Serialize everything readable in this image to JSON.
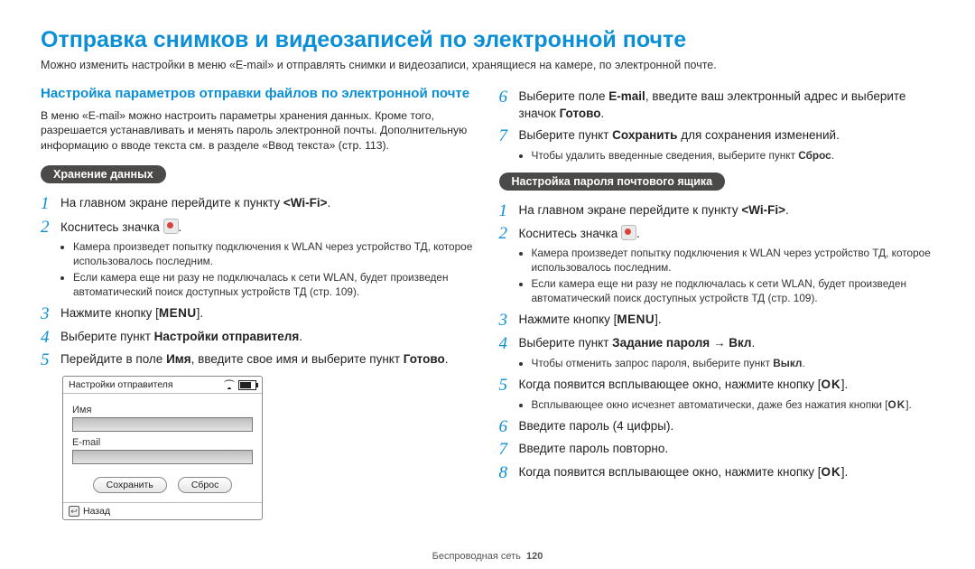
{
  "title": "Отправка снимков и видеозаписей по электронной почте",
  "subtitle": "Можно изменить настройки в меню «E-mail» и отправлять снимки и видеозаписи, хранящиеся на камере, по электронной почте.",
  "left": {
    "heading": "Настройка параметров отправки файлов по электронной почте",
    "intro": "В меню «E-mail» можно настроить параметры хранения данных. Кроме того, разрешается устанавливать и менять пароль электронной почты. Дополнительную информацию о вводе текста см. в разделе «Ввод текста» (стр. 113).",
    "pill": "Хранение данных",
    "s1_a": "На главном экране перейдите к пункту ",
    "s1_b": "<Wi-Fi>",
    "s1_c": ".",
    "s2_a": "Коснитесь значка ",
    "s2_b": ".",
    "b1": "Камера произведет попытку подключения к WLAN через устройство ТД, которое использовалось последним.",
    "b2": "Если камера еще ни разу не подключалась к сети WLAN, будет произведен автоматический поиск доступных устройств ТД (стр. 109).",
    "s3_a": "Нажмите кнопку [",
    "s3_menu": "MENU",
    "s3_b": "].",
    "s4_a": "Выберите пункт ",
    "s4_b": "Настройки отправителя",
    "s4_c": ".",
    "s5_a": "Перейдите в поле ",
    "s5_b": "Имя",
    "s5_c": ", введите свое имя и выберите пункт ",
    "s5_d": "Готово",
    "s5_e": "."
  },
  "device": {
    "title": "Настройки отправителя",
    "label_name": "Имя",
    "label_email": "E-mail",
    "btn_save": "Сохранить",
    "btn_reset": "Сброс",
    "back": "Назад"
  },
  "right_top": {
    "s6_a": "Выберите поле ",
    "s6_b": "E-mail",
    "s6_c": ", введите ваш электронный адрес и выберите значок ",
    "s6_d": "Готово",
    "s6_e": ".",
    "s7_a": "Выберите пункт ",
    "s7_b": "Сохранить",
    "s7_c": " для сохранения изменений.",
    "b1_a": "Чтобы удалить введенные сведения, выберите пункт ",
    "b1_b": "Сброс",
    "b1_c": "."
  },
  "right": {
    "pill": "Настройка пароля почтового ящика",
    "s1_a": "На главном экране перейдите к пункту ",
    "s1_b": "<Wi-Fi>",
    "s1_c": ".",
    "s2_a": "Коснитесь значка ",
    "s2_b": ".",
    "b1": "Камера произведет попытку подключения к WLAN через устройство ТД, которое использовалось последним.",
    "b2": "Если камера еще ни разу не подключалась к сети WLAN, будет произведен автоматический поиск доступных устройств ТД (стр. 109).",
    "s3_a": "Нажмите кнопку [",
    "s3_menu": "MENU",
    "s3_b": "].",
    "s4_a": "Выберите пункт ",
    "s4_b": "Задание пароля",
    "s4_arrow": " → ",
    "s4_c": "Вкл",
    "s4_d": ".",
    "b3_a": "Чтобы отменить запрос пароля, выберите пункт ",
    "b3_b": "Выкл",
    "b3_c": ".",
    "s5_a": "Когда появится всплывающее окно, нажмите кнопку [",
    "s5_ok": "OK",
    "s5_b": "].",
    "b4_a": "Всплывающее окно исчезнет автоматически, даже без нажатия кнопки [",
    "b4_ok": "OK",
    "b4_b": "].",
    "s6": "Введите пароль (4 цифры).",
    "s7": "Введите пароль повторно.",
    "s8_a": "Когда появится всплывающее окно, нажмите кнопку [",
    "s8_ok": "OK",
    "s8_b": "]."
  },
  "footer": {
    "label": "Беспроводная сеть",
    "page": "120"
  }
}
